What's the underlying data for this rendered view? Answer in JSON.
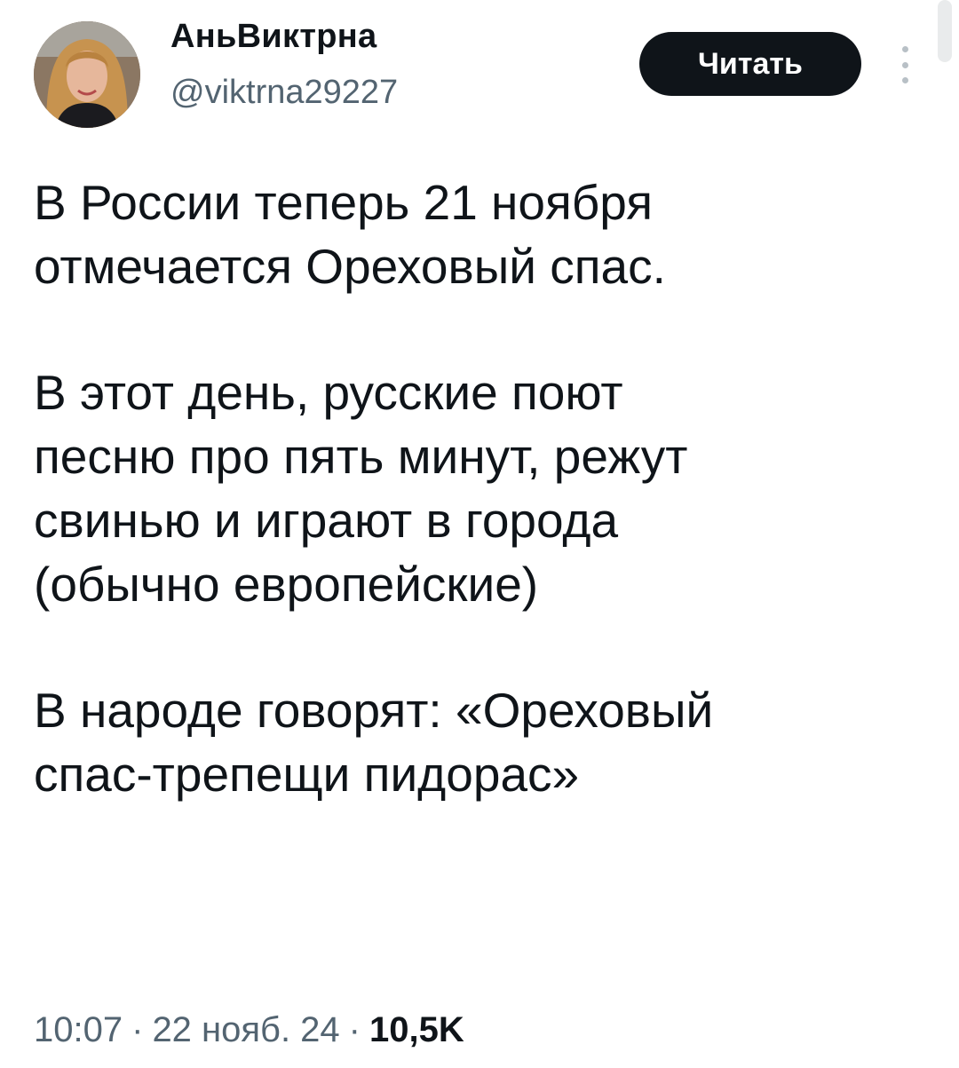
{
  "author": {
    "display_name": "АньВиктрна",
    "username": "@viktrna29227",
    "avatar_icon": "user-avatar-photo"
  },
  "actions": {
    "follow_label": "Читать",
    "more_icon": "vertical-dots-icon"
  },
  "tweet": {
    "paragraphs": [
      "В России теперь 21 ноября\nотмечается Ореховый спас.",
      "В этот день, русские поют\nпесню про пять минут, режут\nсвинью и играют в города\n(обычно европейские)",
      "В народе говорят: «Ореховый\nспас-трепещи пидорас»"
    ]
  },
  "meta": {
    "time": "10:07",
    "separator": "·",
    "date": "22 нояб. 24",
    "views": "10,5K"
  },
  "colors": {
    "text": "#0f1419",
    "secondary": "#536471",
    "button_bg": "#0f1419",
    "button_text": "#ffffff",
    "background": "#ffffff"
  }
}
